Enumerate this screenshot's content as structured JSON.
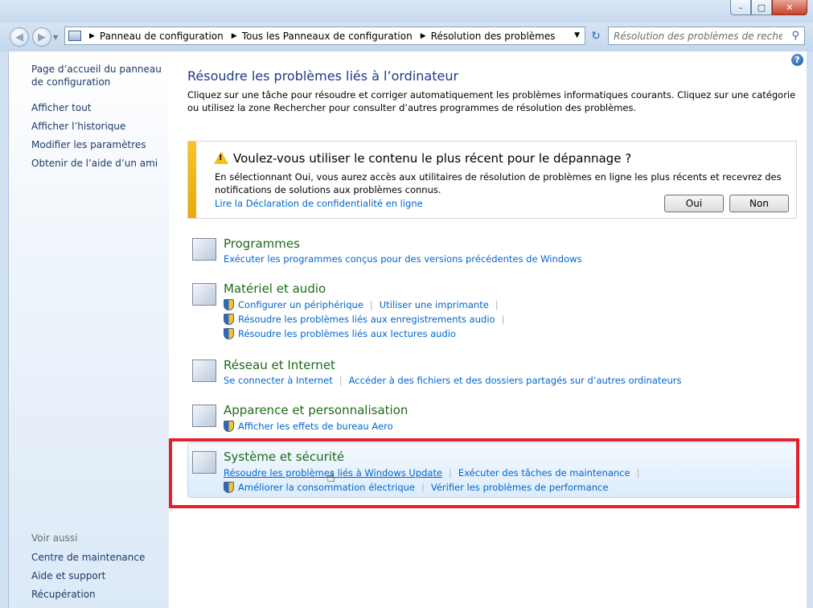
{
  "window": {
    "controls": {
      "minimize": "–",
      "maximize": "□",
      "close": "✕"
    }
  },
  "nav": {
    "back_icon": "back-arrow-icon",
    "forward_icon": "forward-arrow-icon",
    "breadcrumbs": [
      "Panneau de configuration",
      "Tous les Panneaux de configuration",
      "Résolution des problèmes"
    ],
    "search_placeholder": "Résolution des problèmes de recherche"
  },
  "sidebar": {
    "home": "Page d’accueil du panneau de configuration",
    "items": [
      "Afficher tout",
      "Afficher l’historique",
      "Modifier les paramètres",
      "Obtenir de l’aide d’un ami"
    ],
    "see_also_label": "Voir aussi",
    "see_also": [
      "Centre de maintenance",
      "Aide et support",
      "Récupération"
    ]
  },
  "main": {
    "title": "Résoudre les problèmes liés à l’ordinateur",
    "intro": "Cliquez sur une tâche pour résoudre et corriger automatiquement les problèmes informatiques courants. Cliquez sur une catégorie ou utilisez la zone Rechercher pour consulter d’autres programmes de résolution des problèmes.",
    "notice": {
      "title": "Voulez-vous utiliser le contenu le plus récent pour le dépannage ?",
      "text": "En sélectionnant Oui, vous aurez accès aux utilitaires de résolution de problèmes en ligne les plus récents et recevrez des notifications de solutions aux problèmes connus.",
      "link": "Lire la Déclaration de confidentialité en ligne",
      "yes": "Oui",
      "no": "Non"
    },
    "categories": [
      {
        "title": "Programmes",
        "links": [
          "Exécuter les programmes conçus pour des versions précédentes de Windows"
        ]
      },
      {
        "title": "Matériel et audio",
        "links": [
          "Configurer un périphérique",
          "Utiliser une imprimante",
          "Résoudre les problèmes liés aux enregistrements audio",
          "Résoudre les problèmes liés aux lectures audio"
        ]
      },
      {
        "title": "Réseau et Internet",
        "links": [
          "Se connecter à Internet",
          "Accéder à des fichiers et des dossiers partagés sur d’autres ordinateurs"
        ]
      },
      {
        "title": "Apparence et personnalisation",
        "links": [
          "Afficher les effets de bureau Aero"
        ]
      },
      {
        "title": "Système et sécurité",
        "links": [
          "Résoudre les problèmes liés à Windows Update",
          "Exécuter des tâches de maintenance",
          "Améliorer la consommation électrique",
          "Vérifier les problèmes de performance"
        ]
      }
    ]
  }
}
